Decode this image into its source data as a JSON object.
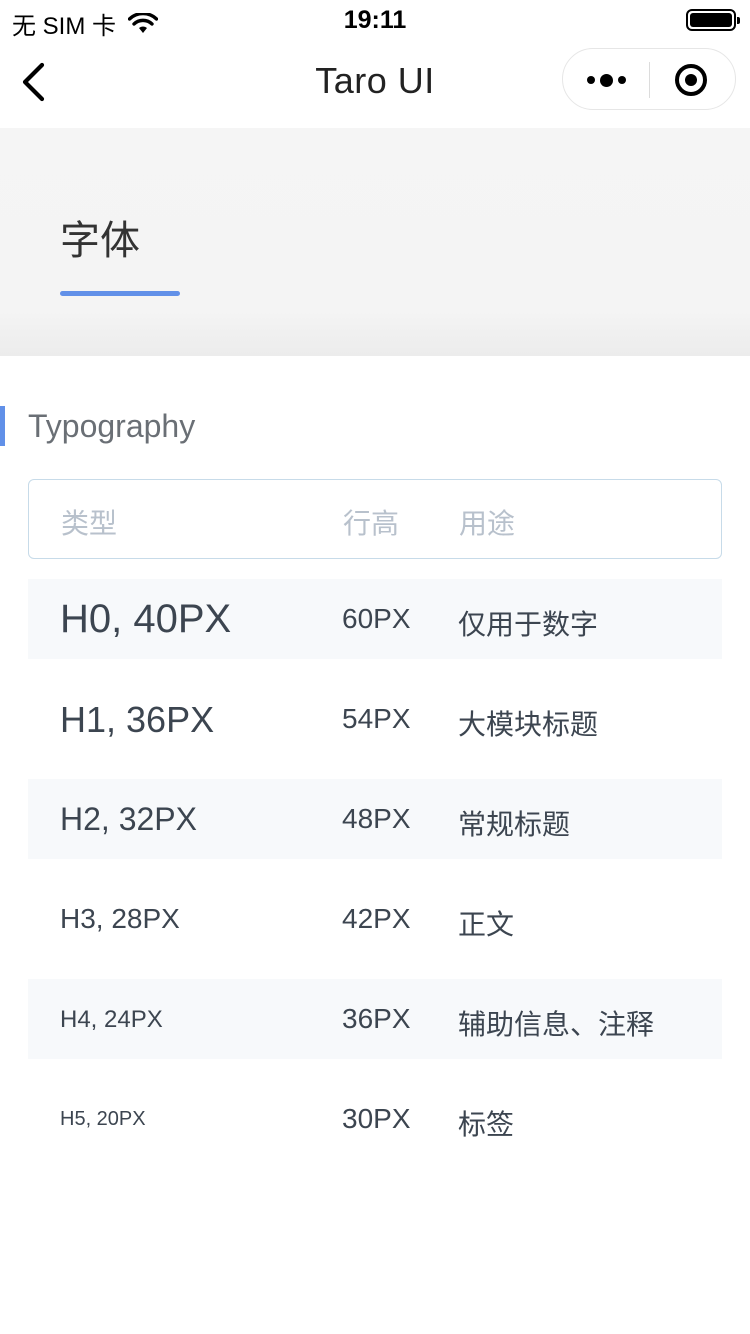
{
  "status_bar": {
    "carrier": "无 SIM 卡",
    "time": "19:11"
  },
  "nav": {
    "title": "Taro UI"
  },
  "header": {
    "title": "字体"
  },
  "section": {
    "title": "Typography"
  },
  "table": {
    "headers": [
      "类型",
      "行高",
      "用途"
    ],
    "rows": [
      [
        "H0, 40PX",
        "60PX",
        "仅用于数字"
      ],
      [
        "H1, 36PX",
        "54PX",
        "大模块标题"
      ],
      [
        "H2, 32PX",
        "48PX",
        "常规标题"
      ],
      [
        "H3, 28PX",
        "42PX",
        "正文"
      ],
      [
        "H4, 24PX",
        "36PX",
        "辅助信息、注释"
      ],
      [
        "H5, 20PX",
        "30PX",
        "标签"
      ]
    ]
  },
  "colors": {
    "accent": "#6190e8",
    "row_stripe": "#f7f9fb",
    "header_border": "#c7dbe9",
    "header_text": "#b8c1cc",
    "body_text": "#3c4550"
  }
}
